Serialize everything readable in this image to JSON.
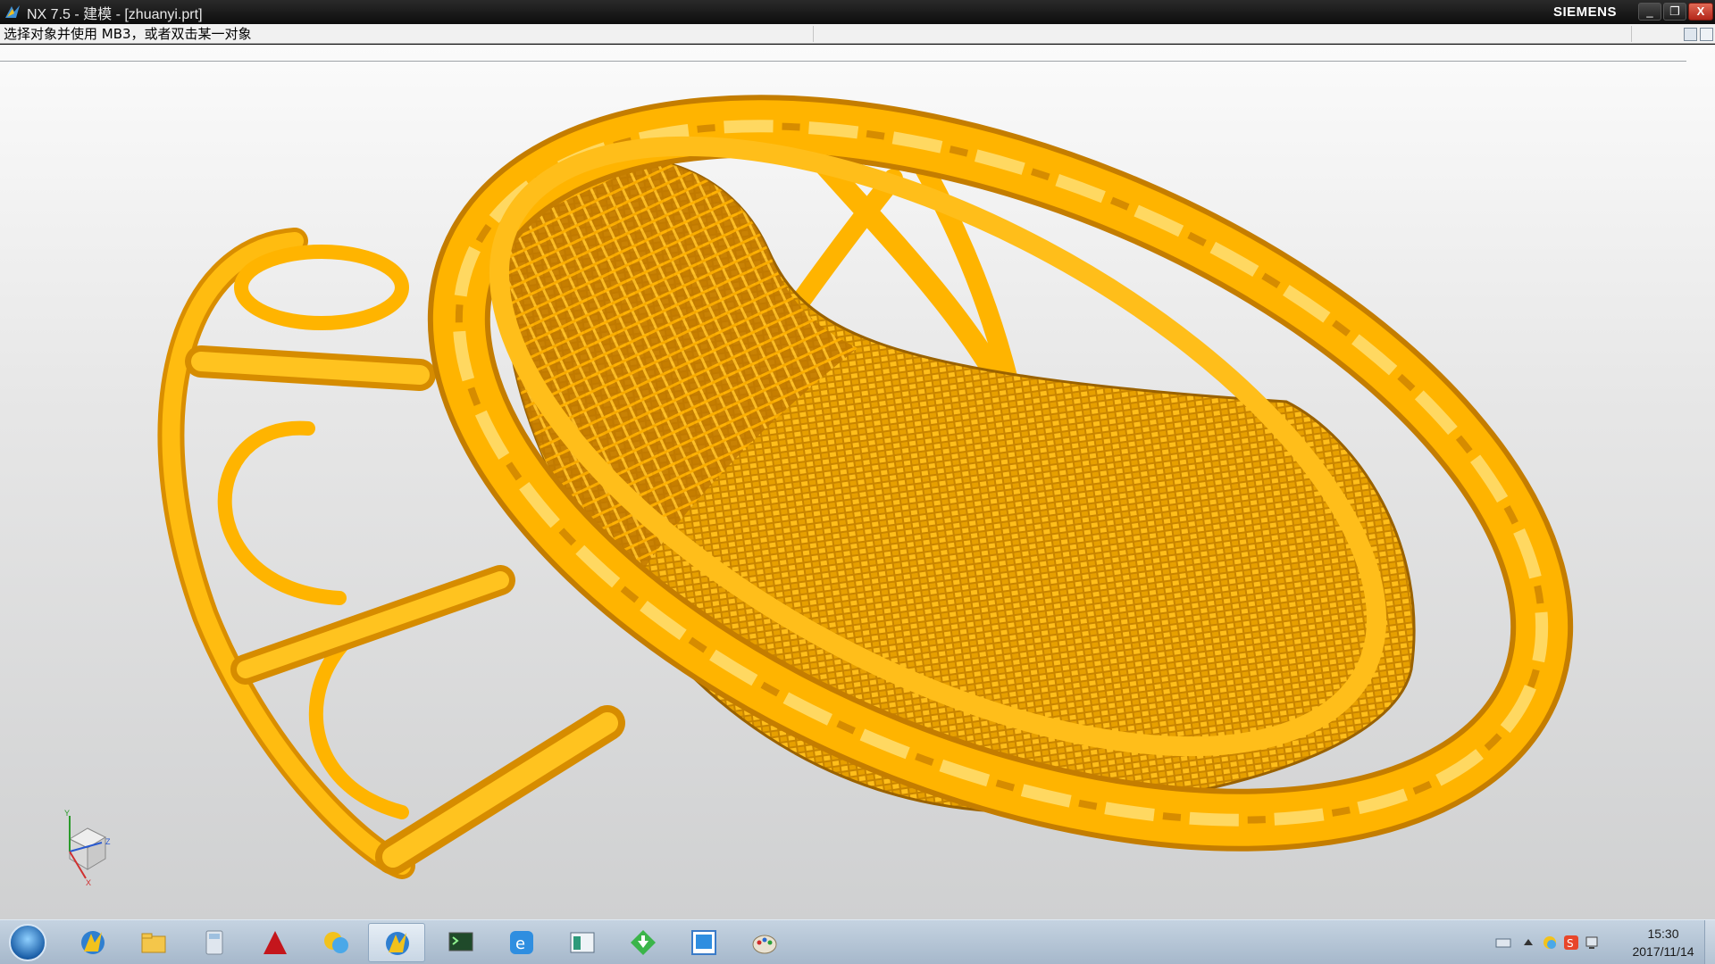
{
  "window": {
    "title": "NX 7.5 - 建模 - [zhuanyi.prt]",
    "brand": "SIEMENS",
    "minimize_glyph": "_",
    "maximize_glyph": "❐",
    "close_glyph": "X"
  },
  "cue_line": {
    "text": "选择对象并使用 MB3，或者双击某一对象"
  },
  "viewport": {
    "model_name": "zhuanyi.prt",
    "model_color": "#ffb000",
    "triad_axes": {
      "x": "X",
      "y": "Y",
      "z": "Z"
    }
  },
  "taskbar": {
    "start_icon": "windows-start-icon",
    "items": [
      {
        "name": "nx-icon",
        "active": false
      },
      {
        "name": "file-explorer-icon",
        "active": false
      },
      {
        "name": "calculator-icon",
        "active": false
      },
      {
        "name": "autocad-icon",
        "active": false
      },
      {
        "name": "chat-icon",
        "active": false
      },
      {
        "name": "nx-icon",
        "active": true
      },
      {
        "name": "terminal-icon",
        "active": false
      },
      {
        "name": "browser-icon",
        "active": false
      },
      {
        "name": "window-app-icon",
        "active": false
      },
      {
        "name": "download-icon",
        "active": false
      },
      {
        "name": "blue-app-icon",
        "active": false
      },
      {
        "name": "paint-icon",
        "active": false
      }
    ],
    "clock": {
      "time": "15:30",
      "date": "2017/11/14"
    }
  }
}
